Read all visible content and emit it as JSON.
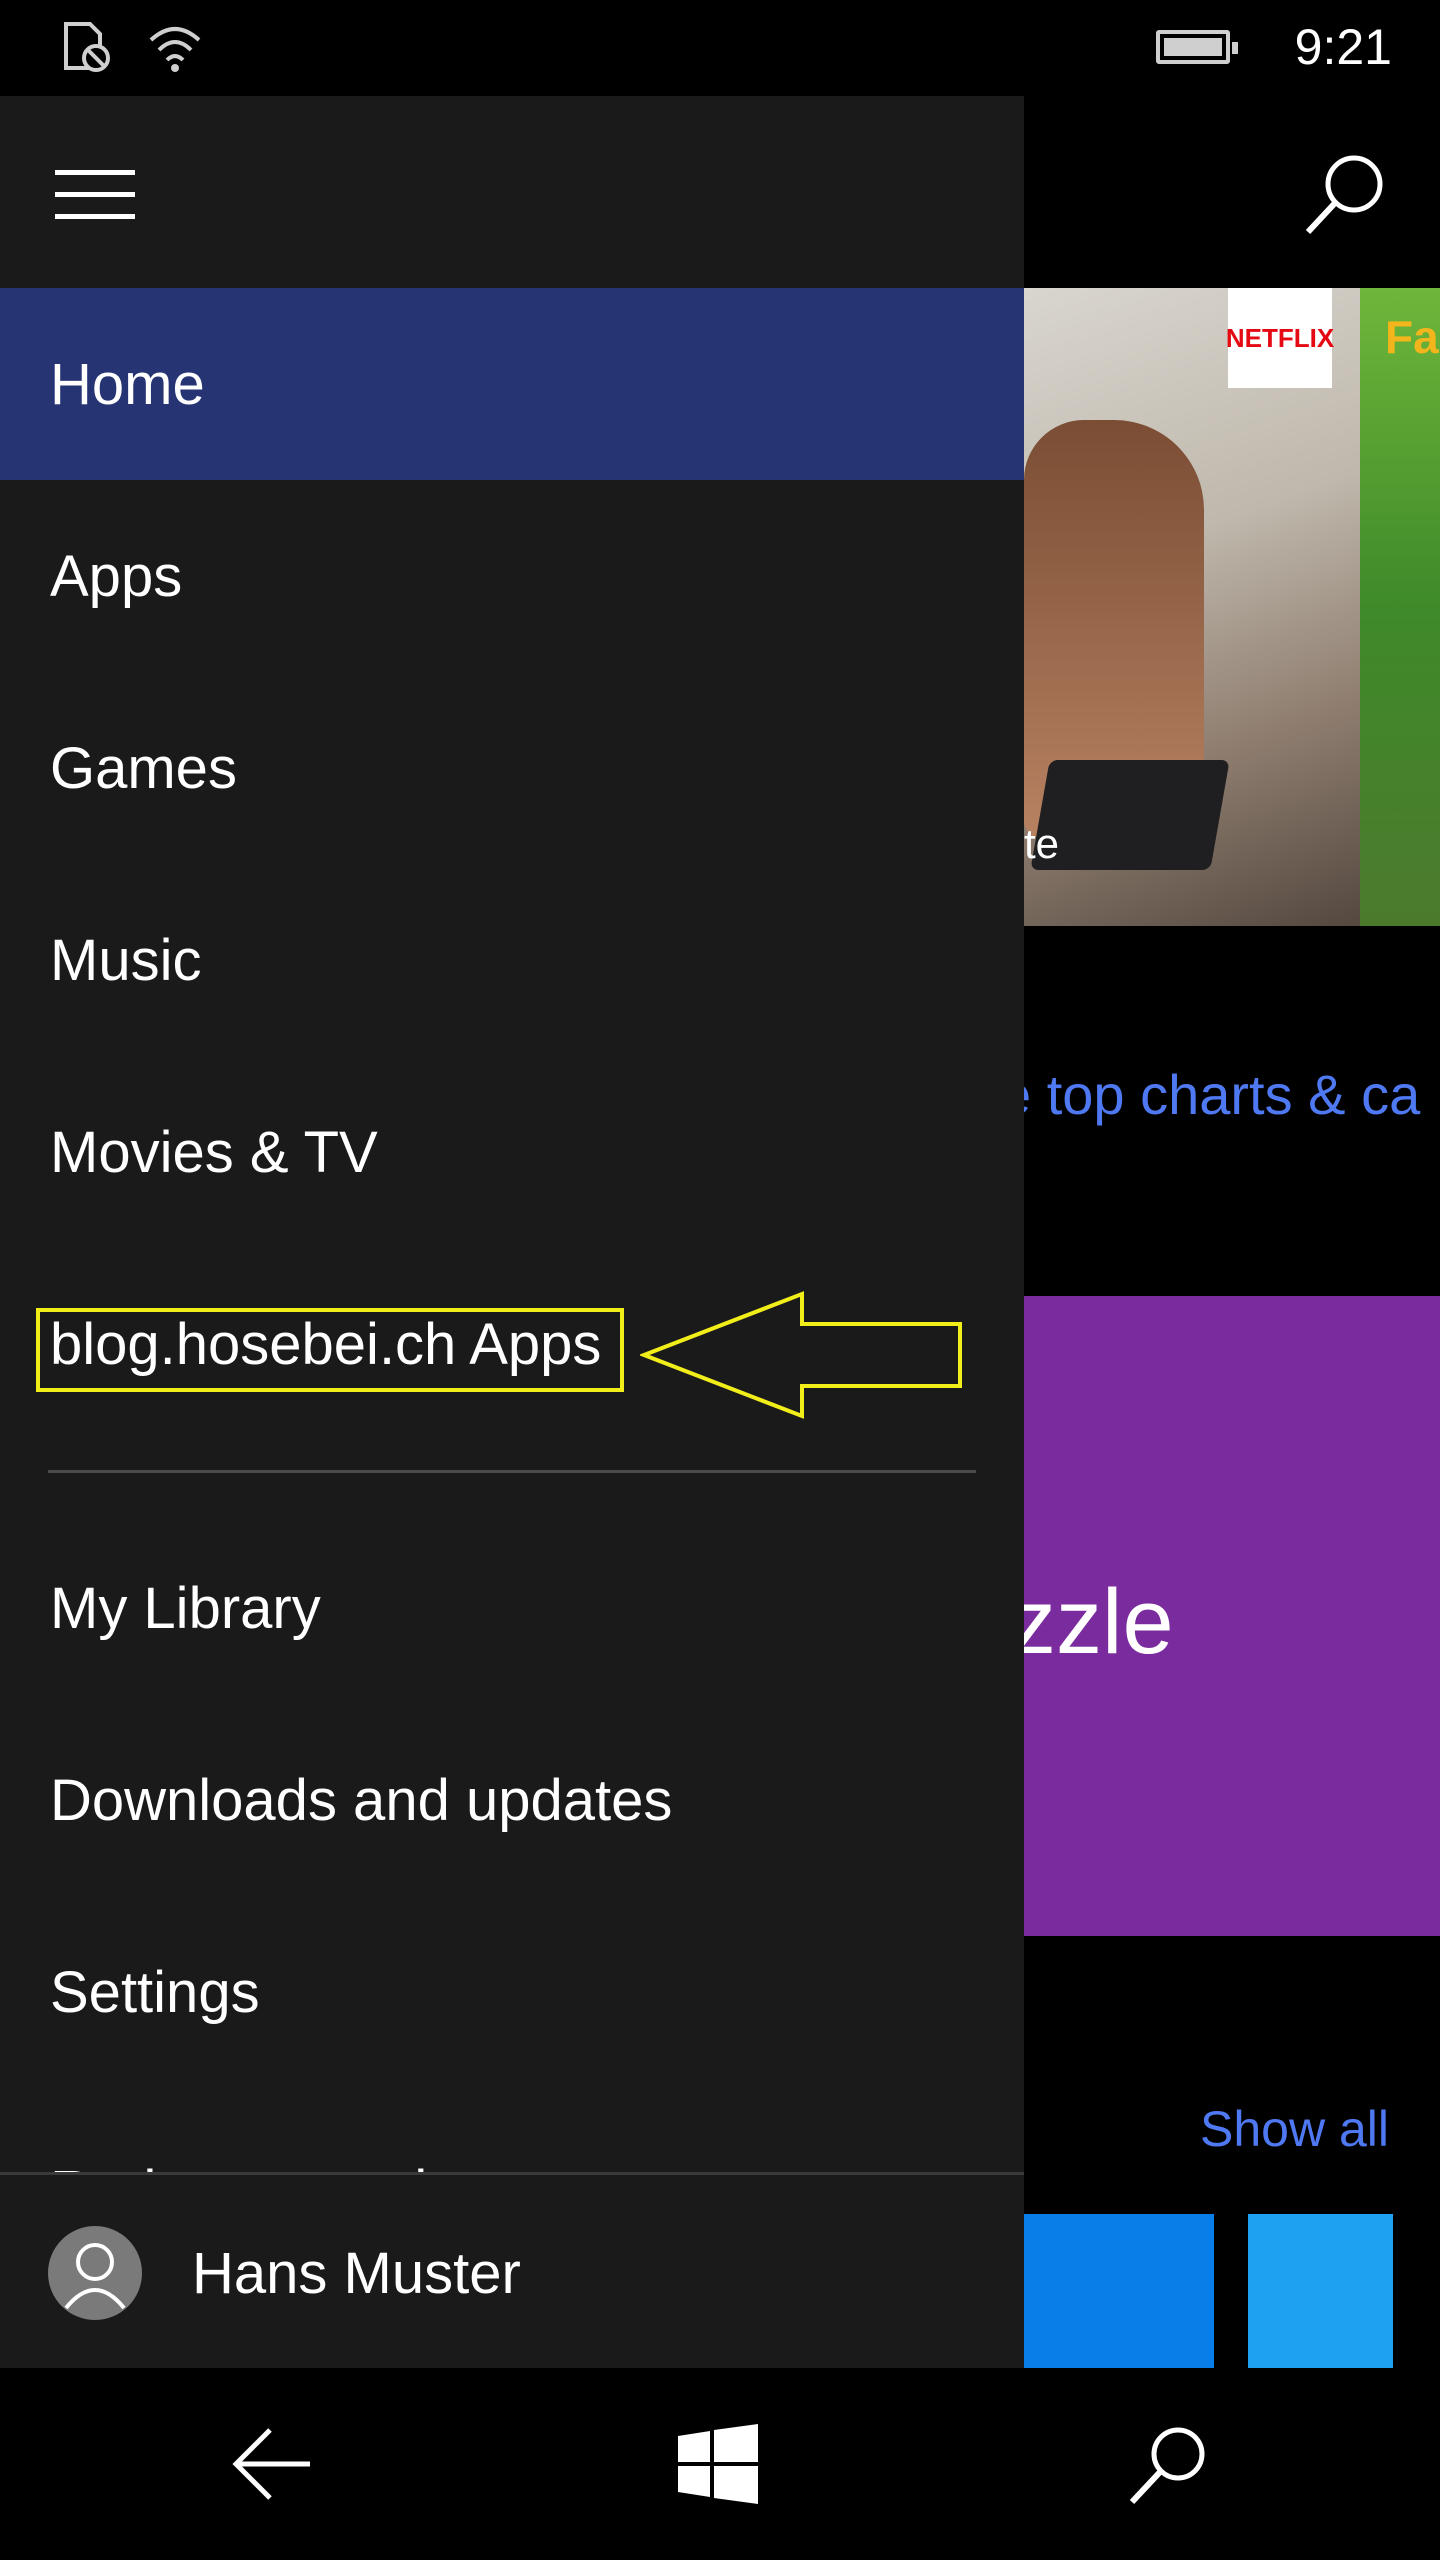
{
  "status_bar": {
    "time": "9:21",
    "icons": [
      "no-sim-icon",
      "wifi-icon",
      "battery-icon"
    ]
  },
  "background": {
    "hero_badge": "NETFLIX",
    "hero_caption": "te",
    "hero2_title": "Fa",
    "charts_link": "e top charts & ca",
    "purple_tile_title": "zzle",
    "show_all": "Show all"
  },
  "nav": {
    "items": [
      {
        "label": "Home",
        "selected": true
      },
      {
        "label": "Apps"
      },
      {
        "label": "Games"
      },
      {
        "label": "Music"
      },
      {
        "label": "Movies & TV"
      },
      {
        "label": "blog.hosebei.ch Apps",
        "annotated": true
      },
      {
        "label": "My Library"
      },
      {
        "label": "Downloads and updates"
      },
      {
        "label": "Settings"
      },
      {
        "label": "Redeem a code"
      }
    ]
  },
  "account": {
    "name": "Hans Muster"
  },
  "colors": {
    "pane_bg": "#1a1a1a",
    "selected_bg": "#263474",
    "link": "#4f79f3",
    "annotation": "#f2ee1a",
    "purple_tile": "#7a2c9e"
  }
}
